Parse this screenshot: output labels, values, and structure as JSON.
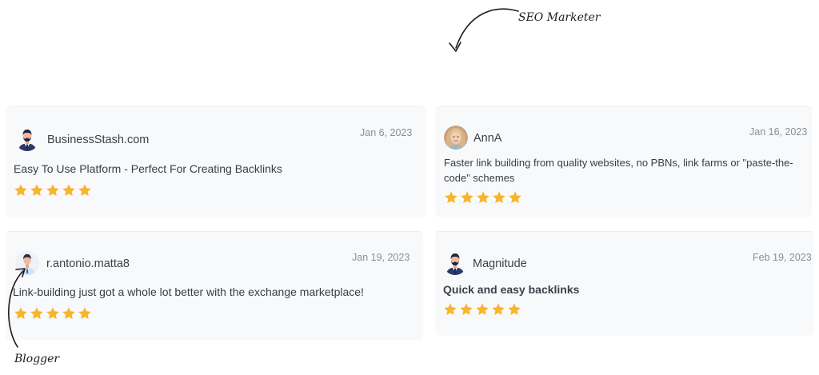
{
  "annotations": {
    "seo_label": "SEO Marketer",
    "blogger_label": "Blogger"
  },
  "colors": {
    "star": "#f7b52c",
    "card_bg": "#f8f9fb",
    "navy": "#2c3a66"
  },
  "reviews": [
    {
      "name": "BusinessStash.com",
      "date": "Jan 6, 2023",
      "text": "Easy To Use Platform - Perfect For Creating Backlinks",
      "rating": 5,
      "avatar_icon": "businessman-avatar-icon"
    },
    {
      "name": "AnnA",
      "date": "Jan 16, 2023",
      "text": "Faster link building from quality websites, no PBNs, link farms or \"paste-the-code\" schemes",
      "rating": 5,
      "avatar_icon": "woman-photo-avatar"
    },
    {
      "name": "r.antonio.matta8",
      "date": "Jan 19, 2023",
      "text": "Link-building just got a whole lot better with the exchange marketplace!",
      "rating": 5,
      "avatar_icon": "man-light-shirt-avatar-icon"
    },
    {
      "name": "Magnitude",
      "date": "Feb 19, 2023",
      "text": "Quick and easy backlinks",
      "rating": 5,
      "avatar_icon": "businessman-avatar-icon"
    }
  ]
}
